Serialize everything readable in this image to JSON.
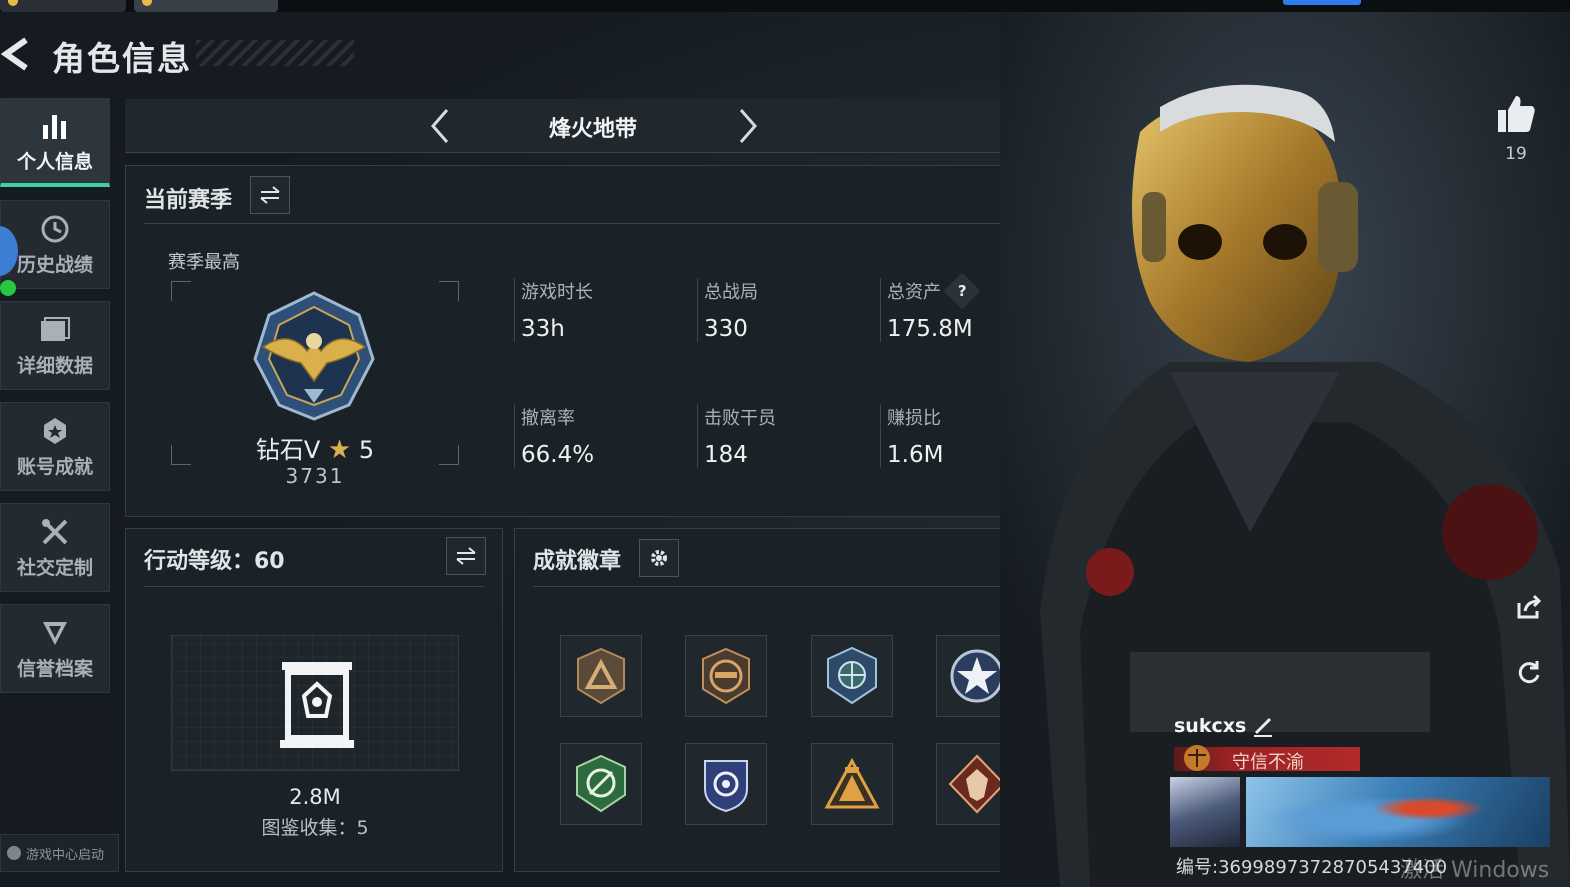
{
  "header": {
    "title": "角色信息"
  },
  "sidebar": {
    "items": [
      {
        "label": "个人信息",
        "icon": "bar-chart-icon",
        "active": true
      },
      {
        "label": "历史战绩",
        "icon": "clock-icon",
        "active": false
      },
      {
        "label": "详细数据",
        "icon": "folder-icon",
        "active": false
      },
      {
        "label": "账号成就",
        "icon": "medal-icon",
        "active": false
      },
      {
        "label": "社交定制",
        "icon": "tools-icon",
        "active": false
      },
      {
        "label": "信誉档案",
        "icon": "shield-v-icon",
        "active": false
      }
    ],
    "bottom_label": "游戏中心启动"
  },
  "mode": {
    "name": "烽火地带"
  },
  "season": {
    "heading": "当前赛季",
    "sub_label": "赛季最高",
    "rank_name": "钻石V",
    "rank_star": "★",
    "rank_stars": "5",
    "rank_score": "3731",
    "stats": [
      {
        "label": "游戏时长",
        "value": "33h"
      },
      {
        "label": "总战局",
        "value": "330"
      },
      {
        "label": "总资产",
        "value": "175.8M",
        "help": "?"
      },
      {
        "label": "撤离率",
        "value": "66.4%"
      },
      {
        "label": "击败干员",
        "value": "184"
      },
      {
        "label": "赚损比",
        "value": "1.6M"
      }
    ]
  },
  "level": {
    "heading": "行动等级：60",
    "value": "2.8M",
    "collection": "图鉴收集：5"
  },
  "badges": {
    "heading": "成就徽章",
    "items": [
      "triangle-badge",
      "pistol-badge",
      "crosshair-badge",
      "star-badge",
      "scope-badge",
      "blue-crest-badge",
      "tent-badge",
      "wolf-badge"
    ]
  },
  "profile": {
    "likes": "19",
    "name": "sukcxs",
    "title": "守信不渝",
    "uid": "编号:36998973728705437400"
  },
  "watermark": "激活 Windows",
  "colors": {
    "accent": "#3fd1a1",
    "gold": "#d9b04a",
    "title_red": "#b22a2a"
  }
}
